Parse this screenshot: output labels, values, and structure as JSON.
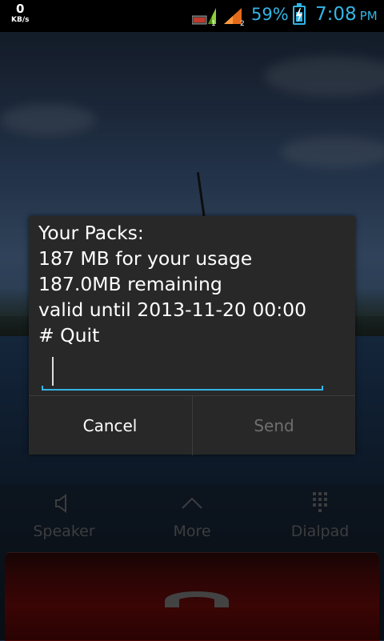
{
  "status": {
    "data_rate_value": "0",
    "data_rate_unit": "KB/s",
    "sim1_badge": "1",
    "sim2_badge": "2",
    "battery_percent": "59%",
    "battery_level": 0.59,
    "time": "7:08",
    "ampm": "PM",
    "accent": "#33b5e5"
  },
  "dialog": {
    "message_lines": [
      "Your Packs:",
      "187 MB for your usage",
      "187.0MB remaining",
      "valid until 2013-11-20 00:00",
      "# Quit"
    ],
    "input_value": "",
    "cancel_label": "Cancel",
    "send_label": "Send"
  },
  "call_controls": {
    "speaker_label": "Speaker",
    "more_label": "More",
    "dialpad_label": "Dialpad"
  },
  "icons": {
    "speaker": "speaker-icon",
    "more": "chevron-up-icon",
    "dialpad": "dialpad-icon",
    "end_call": "end-call-icon"
  },
  "colors": {
    "end_call_bar": "#6a0a0a"
  }
}
